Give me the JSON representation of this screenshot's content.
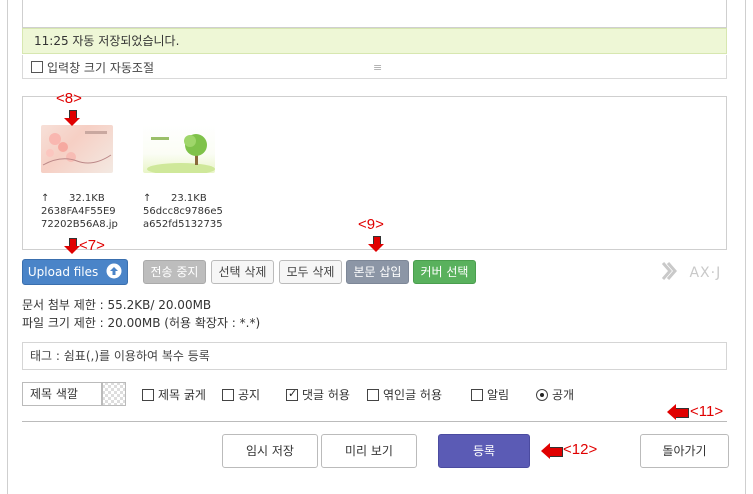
{
  "autosave": {
    "text": "11:25 자동 저장되었습니다."
  },
  "resize": {
    "label": "입력창 크기 자동조절",
    "handle": "≡"
  },
  "files": [
    {
      "size": "32.1KB",
      "name_line1": "2638FA4F55E9",
      "name_line2": "72202B56A8.jp",
      "arrow": "↑"
    },
    {
      "size": "23.1KB",
      "name_line1": "56dcc8c9786e5",
      "name_line2": "a652fd5132735",
      "arrow": "↑"
    }
  ],
  "buttons": {
    "upload": "Upload files",
    "cancel_upload": "전송 중지",
    "delete_selected": "선택 삭제",
    "delete_all": "모두 삭제",
    "insert_body": "본문 삽입",
    "select_cover": "커버 선택"
  },
  "logo": "AX·J",
  "limits": {
    "doc_limit": "문서 첨부 제한 : 55.2KB/ 20.00MB",
    "file_limit": "파일 크기 제한 : 20.00MB (허용 확장자 : *.*)"
  },
  "tag": {
    "placeholder": "태그 : 쉼표(,)를 이용하여 복수 등록"
  },
  "options": {
    "title_color": "제목 색깔",
    "bold_title": "제목 굵게",
    "notice": "공지",
    "allow_comment": "댓글 허용",
    "allow_trackback": "엮인글 허용",
    "alarm": "알림",
    "public": "공개"
  },
  "bottom": {
    "temp_save": "임시 저장",
    "preview": "미리 보기",
    "submit": "등록",
    "back": "돌아가기"
  },
  "annotations": {
    "a7": "<7>",
    "a8": "<8>",
    "a9": "<9>",
    "a11": "<11>",
    "a12": "<12>"
  },
  "colors": {
    "primary": "#5b5bb5",
    "upload": "#4a84c8",
    "cover": "#59b15d",
    "annotation": "#e00000"
  }
}
